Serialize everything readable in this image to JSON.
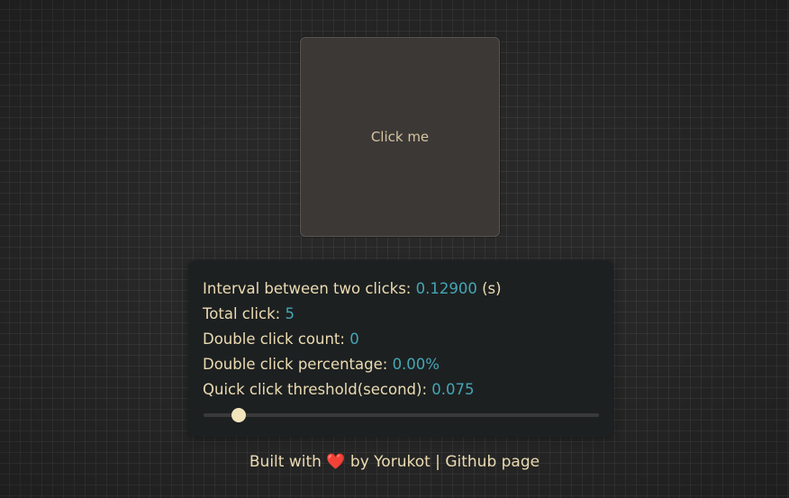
{
  "click_button": {
    "label": "Click me"
  },
  "stats": {
    "interval": {
      "label": "Interval between two clicks: ",
      "value": "0.12900",
      "unit": " (s)"
    },
    "total": {
      "label": "Total click: ",
      "value": "5"
    },
    "double_count": {
      "label": "Double click count: ",
      "value": "0"
    },
    "double_percentage": {
      "label": "Double click percentage: ",
      "value": "0.00%"
    },
    "threshold": {
      "label": "Quick click threshold(second): ",
      "value": "0.075"
    }
  },
  "slider": {
    "value": 0.075,
    "min": 0,
    "max": 1,
    "fraction": 0.089
  },
  "footer": {
    "prefix": "Built with ",
    "heart": "❤️",
    "by": " by ",
    "author": "Yorukot",
    "separator": " | ",
    "github_link": "Github page"
  },
  "colors": {
    "accent_value": "#45a6b5",
    "text": "#ebdbb2",
    "panel_bg": "#1d2021",
    "button_bg": "#3c3836",
    "heart": "#e01b24"
  }
}
